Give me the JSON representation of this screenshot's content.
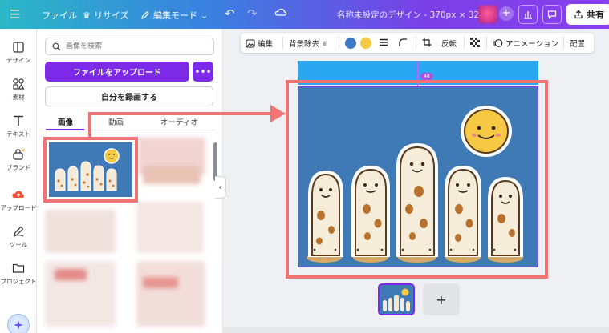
{
  "topbar": {
    "file": "ファイル",
    "resize": "リサイズ",
    "edit_mode": "編集モード",
    "doc_title": "名称未設定のデザイン - 370px × 320px",
    "share": "共有"
  },
  "rail": [
    {
      "label": "デザイン",
      "icon": "layout-icon"
    },
    {
      "label": "素材",
      "icon": "elements-icon"
    },
    {
      "label": "テキスト",
      "icon": "text-icon"
    },
    {
      "label": "ブランド",
      "icon": "brand-icon"
    },
    {
      "label": "アップロード",
      "icon": "upload-icon"
    },
    {
      "label": "ツール",
      "icon": "draw-icon"
    },
    {
      "label": "プロジェクト",
      "icon": "folder-icon"
    }
  ],
  "panel": {
    "search_placeholder": "画像を検索",
    "upload_button": "ファイルをアップロード",
    "more_button": "•••",
    "record_button": "自分を録画する",
    "tabs": [
      "画像",
      "動画",
      "オーディオ"
    ],
    "active_tab": "画像"
  },
  "context_toolbar": {
    "edit": "編集",
    "bg_remove": "背景除去",
    "flip": "反転",
    "animate": "アニメーション",
    "position": "配置",
    "color_blue": "#3f79c6",
    "color_yellow": "#f6c945"
  },
  "canvas": {
    "distance_badge": "48",
    "page_bg": "#3f79b6",
    "highlight": "#f07474",
    "accent": "#7d2ae8"
  },
  "pages": {
    "add_label": "+"
  }
}
